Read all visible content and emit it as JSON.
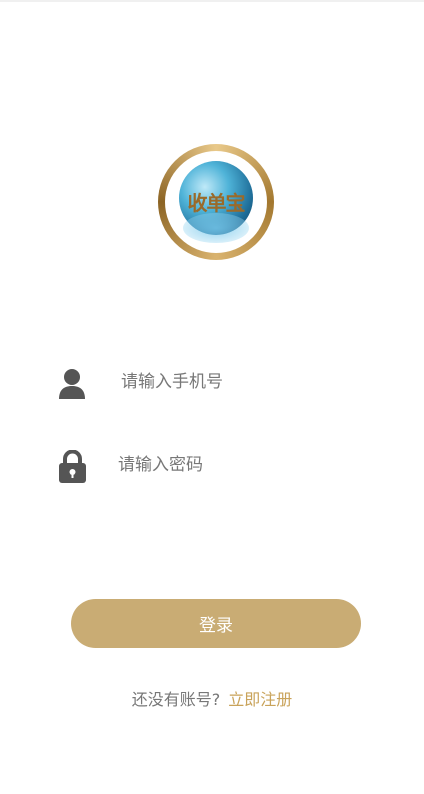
{
  "app": {
    "logo_text": "收单宝",
    "accent_color": "#c9ac74"
  },
  "form": {
    "phone_placeholder": "请输入手机号",
    "phone_value": "",
    "password_placeholder": "请输入密码",
    "password_value": "",
    "user_icon": "user-icon",
    "lock_icon": "lock-icon"
  },
  "actions": {
    "login_label": "登录",
    "no_account_text": "还没有账号?",
    "register_label": "立即注册"
  }
}
